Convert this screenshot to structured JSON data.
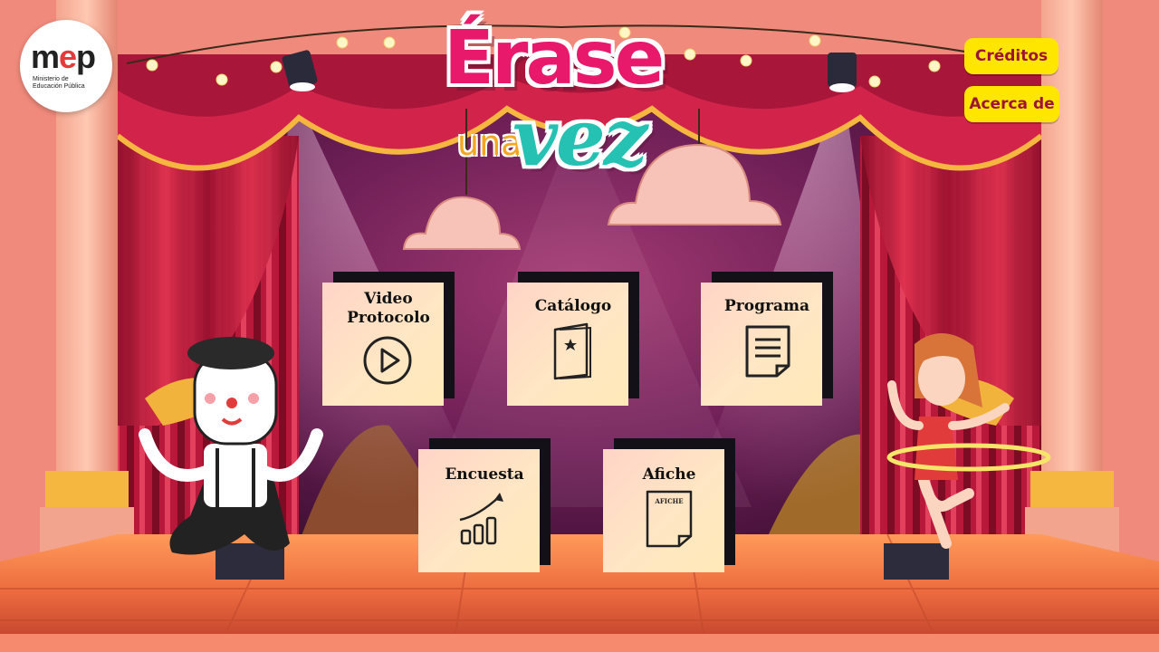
{
  "logo": {
    "word": "mep",
    "subtitle_line1": "Ministerio de",
    "subtitle_line2": "Educación Pública"
  },
  "title": {
    "line1": "Érase",
    "line2a": "una",
    "line2b": "vez"
  },
  "buttons": {
    "creditos": "Créditos",
    "acerca": "Acerca de"
  },
  "cards": {
    "video": {
      "line1": "Video",
      "line2": "Protocolo",
      "icon": "play-icon"
    },
    "catalogo": {
      "label": "Catálogo",
      "icon": "booklet-icon"
    },
    "programa": {
      "label": "Programa",
      "icon": "document-icon"
    },
    "encuesta": {
      "label": "Encuesta",
      "icon": "growth-chart-icon"
    },
    "afiche": {
      "label": "Afiche",
      "icon": "poster-icon",
      "icon_text": "AFICHE"
    }
  },
  "colors": {
    "title_pink": "#e8196a",
    "title_teal": "#25c1b3",
    "button_yellow": "#ffe600",
    "button_text": "#9e1436",
    "curtain_red": "#c9203f"
  }
}
